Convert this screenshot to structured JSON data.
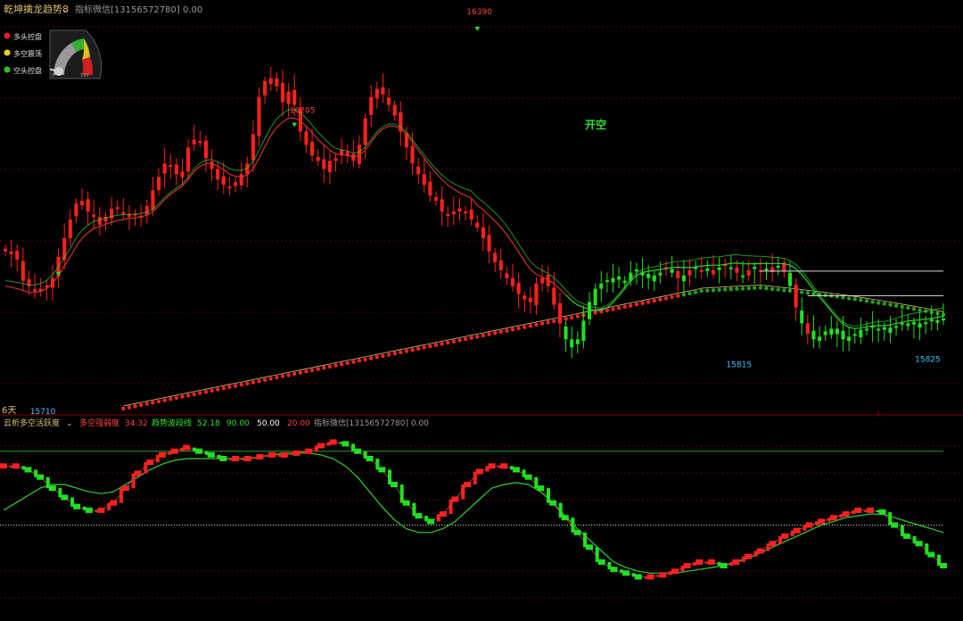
{
  "top_panel": {
    "indicator_name": "乾坤擒龙趋势8",
    "caption_text": "指标微信[13156572780] 0.00",
    "legend": [
      {
        "label": "多头控盘",
        "color": "#e02020"
      },
      {
        "label": "多空震荡",
        "color": "#e8d020"
      },
      {
        "label": "空头控盘",
        "color": "#30c030"
      }
    ],
    "gauge_labels": [
      "0",
      "100"
    ],
    "gauge_value": 15,
    "annotation_open_short": "开空",
    "bottom_left_label": "6天"
  },
  "bottom_panel": {
    "indicator_name": "云析多空活跃度",
    "series_a_label": "多空强弱度",
    "series_a_value": "34.32",
    "series_b_label": "趋势波段线",
    "series_b_value": "52.18",
    "level_high": "90.00",
    "level_mid": "50.00",
    "level_low": "20.00",
    "caption_text": "指标微信[13156572780] 0.00"
  },
  "colors": {
    "bull": "#ff2020",
    "bear": "#20e020",
    "ma_red": "#d03030",
    "ma_green": "#30d030",
    "ma_yellow": "#d8c070",
    "dot_green": "#20a020",
    "grid": "#5a0000",
    "label_red": "#ff4040",
    "label_cyan": "#40c0ff"
  },
  "chart_data": [
    {
      "type": "candlestick",
      "y_unit": "price",
      "ylim": [
        15700,
        16420
      ],
      "price_labels": [
        {
          "text": "16390",
          "value": 16390,
          "bar": 80
        },
        {
          "text": "16205",
          "value": 16205,
          "bar": 50
        },
        {
          "text": "15815",
          "value": 15815,
          "bar": 124
        },
        {
          "text": "15825",
          "value": 15825,
          "bar": 156
        },
        {
          "text": "15710",
          "value": 15710,
          "bar": 6
        }
      ],
      "close": [
        15995,
        15990,
        15980,
        15940,
        15930,
        15920,
        15925,
        15930,
        15945,
        15985,
        16020,
        16055,
        16085,
        16090,
        16070,
        16060,
        16045,
        16060,
        16075,
        16075,
        16065,
        16060,
        16065,
        16060,
        16080,
        16110,
        16135,
        16160,
        16155,
        16140,
        16145,
        16190,
        16205,
        16200,
        16170,
        16150,
        16130,
        16120,
        16115,
        16125,
        16140,
        16160,
        16215,
        16285,
        16315,
        16320,
        16305,
        16275,
        16295,
        16270,
        16220,
        16195,
        16175,
        16165,
        16150,
        16165,
        16170,
        16185,
        16175,
        16165,
        16195,
        16245,
        16285,
        16300,
        16290,
        16270,
        16250,
        16220,
        16190,
        16160,
        16140,
        16120,
        16100,
        16090,
        16070,
        16065,
        16070,
        16070,
        16070,
        16055
      ],
      "ma_fast": [
        15930,
        15928,
        15925,
        15922,
        15918,
        15918,
        15920,
        15925,
        15935,
        15950,
        15968,
        15985,
        16005,
        16020,
        16030,
        16038,
        16042,
        16046,
        16050,
        16053,
        16055,
        16057,
        16058,
        16060,
        16063,
        16070,
        16080,
        16092,
        16102,
        16110,
        16118,
        16130,
        16145,
        16155,
        16160,
        16160,
        16155,
        16148,
        16140,
        16136,
        16135,
        16138,
        16150,
        16170,
        16192,
        16212,
        16228,
        16238,
        16245,
        16245,
        16240,
        16230,
        16218,
        16205,
        16195,
        16185,
        16178,
        16176,
        16175,
        16172,
        16175,
        16185,
        16200,
        16215,
        16225,
        16230,
        16230,
        16225,
        16215,
        16200,
        16185,
        16170,
        16155,
        16142,
        16130,
        16120,
        16112,
        16105,
        16100,
        16095
      ],
      "bar_count": 160,
      "green_ma_bars_from": 95
    },
    {
      "type": "line",
      "ylim": [
        0,
        100
      ],
      "levels": [
        90,
        50,
        20
      ],
      "series": [
        {
          "name": "多空强弱度",
          "values": [
            82,
            82,
            80,
            76,
            70,
            65,
            60,
            58,
            58,
            62,
            70,
            78,
            84,
            88,
            90,
            92,
            90,
            88,
            86,
            86,
            86,
            87,
            88,
            88,
            89,
            90,
            93,
            95,
            94,
            90,
            86,
            80,
            72,
            62,
            55,
            52,
            56,
            64,
            72,
            79,
            82,
            82,
            80,
            76,
            70,
            62,
            54,
            46,
            38,
            30,
            26,
            24,
            22,
            22,
            23,
            25,
            28,
            30,
            30,
            28,
            30,
            33,
            36,
            40,
            44,
            47,
            50,
            52,
            54,
            56,
            58,
            58,
            57,
            50,
            44,
            40,
            34,
            28
          ]
        },
        {
          "name": "趋势波段线",
          "values": [
            58,
            62,
            66,
            70,
            72,
            72,
            70,
            68,
            67,
            68,
            72,
            76,
            80,
            83,
            85,
            86,
            86,
            86,
            86,
            86,
            86,
            87,
            88,
            89,
            89,
            89,
            88,
            86,
            82,
            76,
            68,
            60,
            53,
            48,
            46,
            46,
            48,
            52,
            58,
            64,
            70,
            72,
            73,
            72,
            68,
            62,
            55,
            48,
            42,
            36,
            30,
            27,
            25,
            24,
            24,
            24,
            25,
            26,
            27,
            28,
            30,
            32,
            35,
            38,
            41,
            44,
            47,
            50,
            52,
            54,
            55,
            56,
            56,
            54,
            52,
            50,
            48,
            46
          ]
        }
      ]
    }
  ]
}
